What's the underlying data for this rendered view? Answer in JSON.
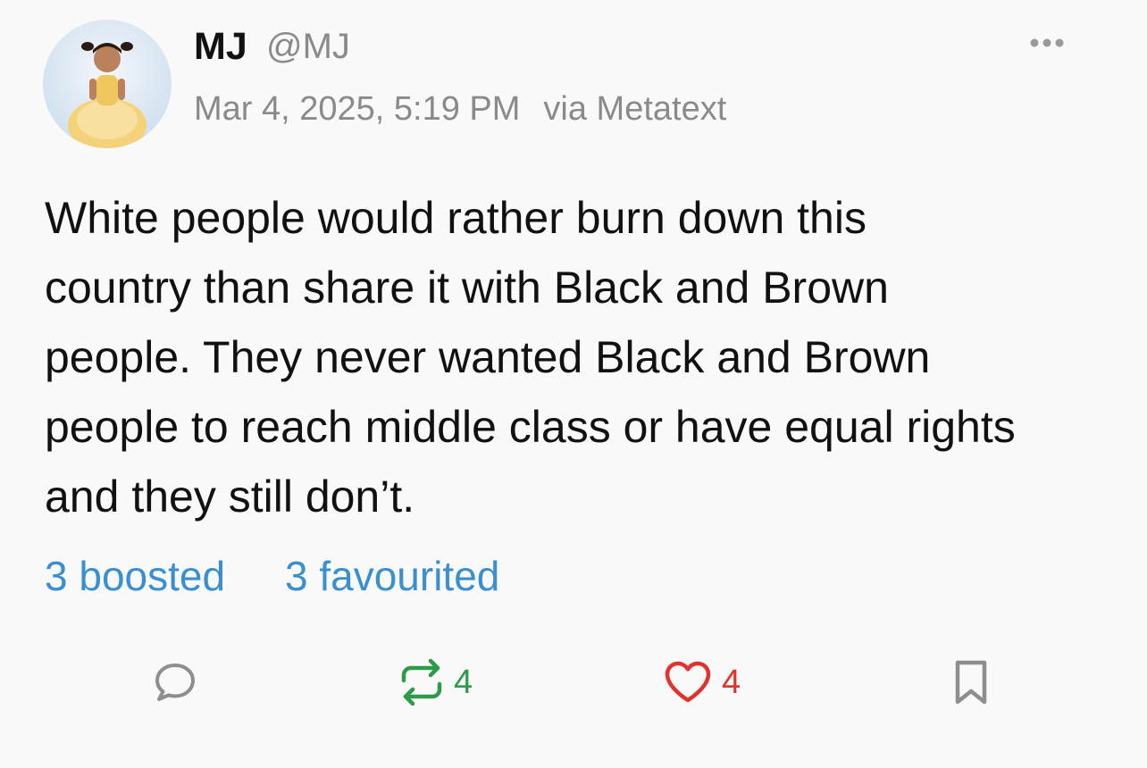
{
  "post": {
    "author": {
      "display_name": "MJ",
      "handle": "@MJ",
      "avatar_icon": "user-avatar-photo"
    },
    "timestamp": "Mar 4, 2025, 5:19 PM",
    "via": "via Metatext",
    "text_lines": [
      "White people would rather burn down this",
      "country than share it with Black and Brown",
      "people. They never wanted Black and Brown",
      "people to reach middle class or have equal rights",
      "and they still don’t."
    ],
    "stats": {
      "boosted": "3 boosted",
      "favourited": "3 favourited"
    },
    "actions": {
      "reply_icon": "speech-bubble-icon",
      "boost_icon": "repeat-icon",
      "boost_count": "4",
      "favourite_icon": "heart-icon",
      "favourite_count": "4",
      "bookmark_icon": "bookmark-icon"
    }
  },
  "colors": {
    "background": "#f9f9f9",
    "link": "#3a8fd1",
    "boost": "#2e9b4a",
    "favourite": "#e0332e",
    "secondary_text": "#8a8a8a"
  }
}
